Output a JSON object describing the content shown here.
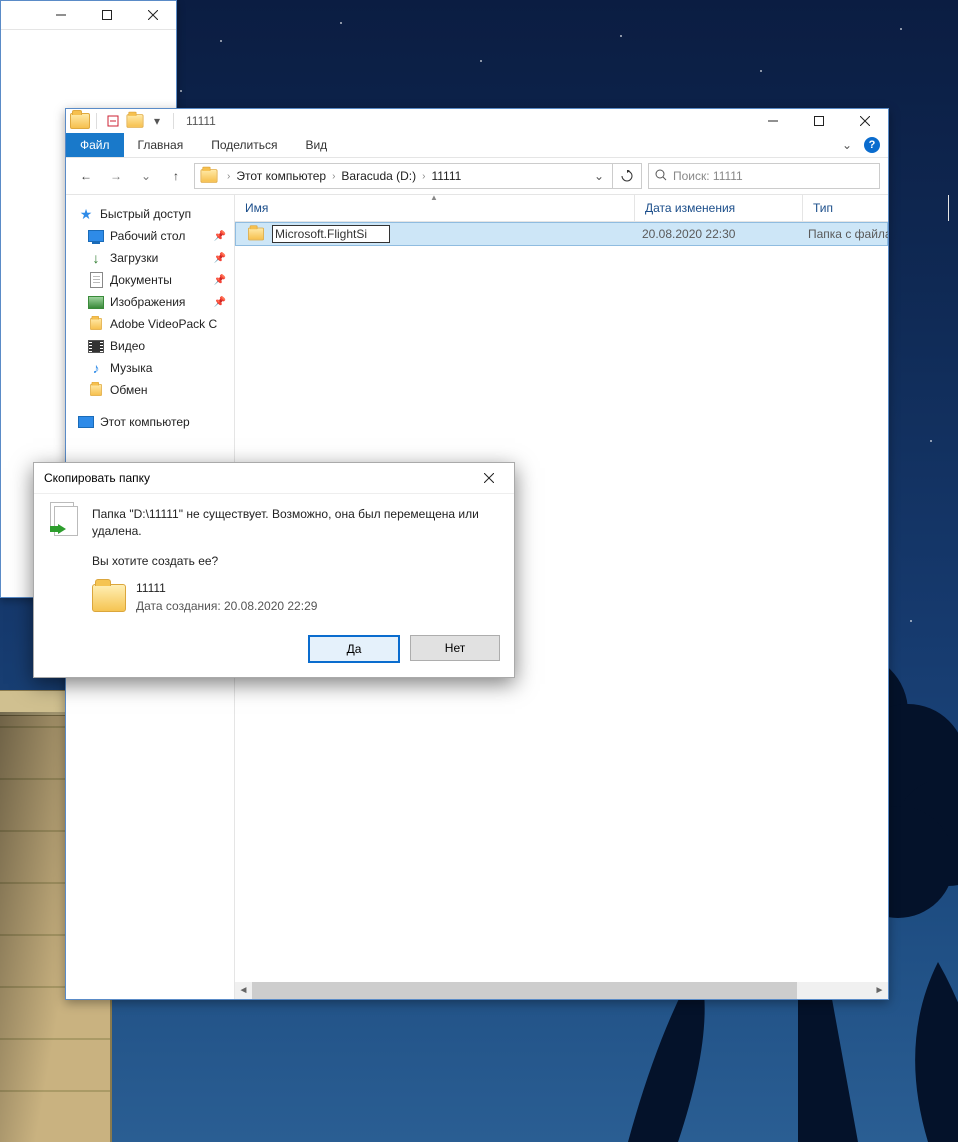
{
  "bgwin": {},
  "explorer": {
    "title": "11111",
    "tabs": {
      "file": "Файл",
      "home": "Главная",
      "share": "Поделиться",
      "view": "Вид"
    },
    "crumbs": {
      "pc": "Этот компьютер",
      "drive": "Baracuda (D:)",
      "folder": "11111"
    },
    "search_placeholder": "Поиск: 11111",
    "sidebar": {
      "quick": "Быстрый доступ",
      "desktop": "Рабочий стол",
      "downloads": "Загрузки",
      "documents": "Документы",
      "pictures": "Изображения",
      "adobe": "Adobe VideoPack C",
      "video": "Видео",
      "music": "Музыка",
      "exchange": "Обмен",
      "thispc": "Этот компьютер"
    },
    "columns": {
      "name": "Имя",
      "date": "Дата изменения",
      "type": "Тип"
    },
    "row": {
      "name": "Microsoft.FlightSi",
      "date": "20.08.2020 22:30",
      "type": "Папка с файлами"
    }
  },
  "dialog": {
    "title": "Скопировать папку",
    "msg": "Папка \"D:\\11111\" не существует. Возможно, она был перемещена или удалена.",
    "question": "Вы хотите создать ее?",
    "item_name": "11111",
    "item_meta": "Дата создания: 20.08.2020 22:29",
    "yes": "Да",
    "no": "Нет"
  }
}
